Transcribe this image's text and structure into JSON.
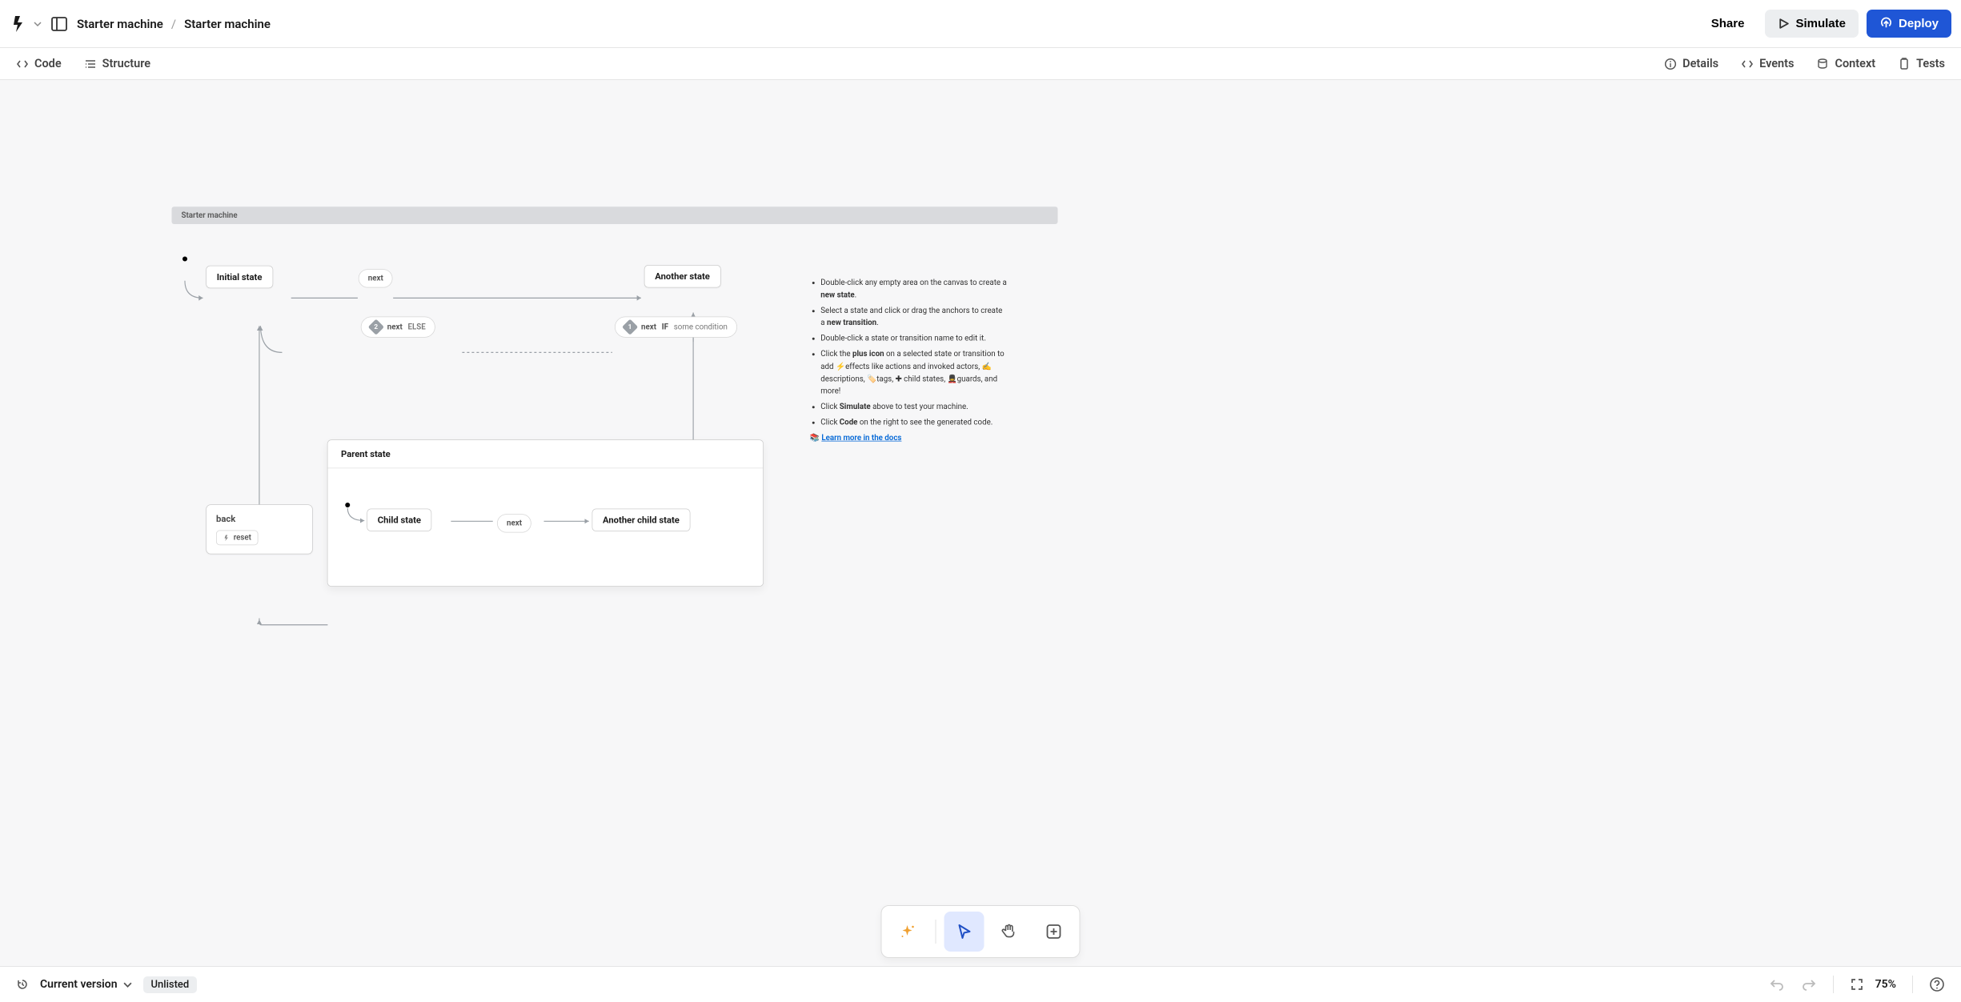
{
  "header": {
    "breadcrumb_parent": "Starter machine",
    "breadcrumb_sep": "/",
    "breadcrumb_current": "Starter machine",
    "share": "Share",
    "simulate": "Simulate",
    "deploy": "Deploy"
  },
  "subtabs": {
    "code": "Code",
    "structure": "Structure",
    "details": "Details",
    "events": "Events",
    "context": "Context",
    "tests": "Tests"
  },
  "machine": {
    "title": "Starter machine",
    "states": {
      "initial": "Initial state",
      "another": "Another state",
      "back": "back",
      "back_action": "reset",
      "parent": "Parent state",
      "child": "Child state",
      "childb": "Another child state"
    },
    "transitions": {
      "next1": "next",
      "next2_badge": "2",
      "next2": "next",
      "next2_else": "ELSE",
      "next3_badge": "1",
      "next3": "next",
      "next3_if": "IF",
      "next3_cond": "some condition",
      "childnext": "next"
    }
  },
  "info": {
    "li1_a": "Double-click any empty area on the canvas to create a ",
    "li1_b": "new state",
    "li1_c": ".",
    "li2_a": "Select a state and click or drag the anchors to create a ",
    "li2_b": "new transition",
    "li2_c": ".",
    "li3": "Double-click a state or transition name to edit it.",
    "li4_a": "Click the ",
    "li4_b": "plus icon",
    "li4_c": " on a selected state or transition to add ⚡effects like actions and invoked actors, ✍️ descriptions, 🏷️tags, ✚ child states, 💂guards, and more!",
    "li5_a": "Click ",
    "li5_b": "Simulate",
    "li5_c": " above to test your machine.",
    "li6_a": "Click ",
    "li6_b": "Code",
    "li6_c": " on the right to see the generated code.",
    "docs_emoji": "📚",
    "docs_link": "Learn more in the docs"
  },
  "bottom": {
    "version": "Current version",
    "unlisted": "Unlisted",
    "zoom": "75%"
  }
}
